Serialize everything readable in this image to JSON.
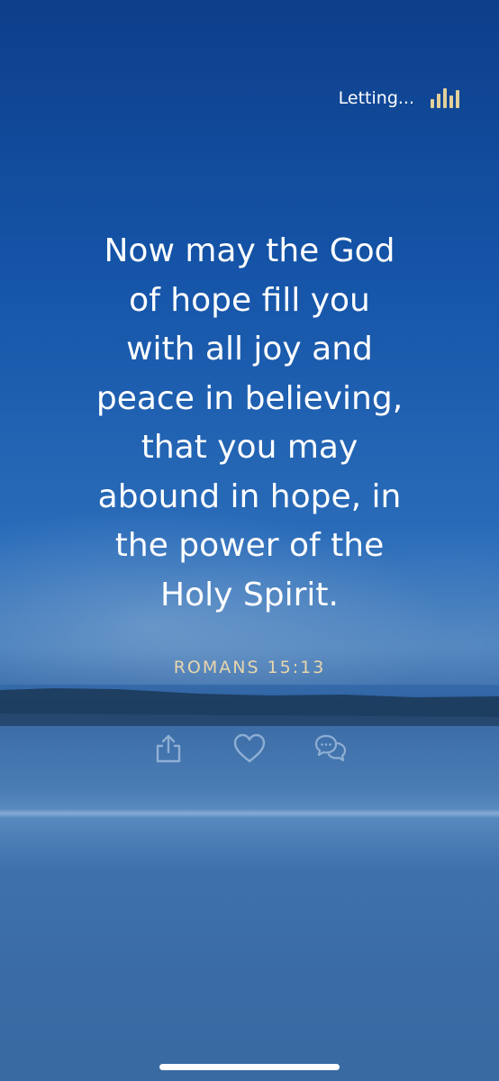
{
  "status": {
    "label": "Letting...",
    "icon": "equalizer-icon",
    "icon_color": "#e3cf9a"
  },
  "verse": {
    "text": "Now may the God of hope fill you with all joy and peace in believing, that you may abound in hope, in the power of the Holy Spirit.",
    "lines": [
      "Now may the God",
      "of hope fill you",
      "with all joy and",
      "peace in believing,",
      "that you may",
      "abound in hope, in",
      "the power of the",
      "Holy Spirit."
    ],
    "reference": "ROMANS 15:13",
    "reference_color": "#e8d6ad"
  },
  "actions": [
    {
      "name": "share",
      "icon": "share-icon"
    },
    {
      "name": "like",
      "icon": "heart-icon"
    },
    {
      "name": "chat",
      "icon": "chat-icon"
    }
  ]
}
